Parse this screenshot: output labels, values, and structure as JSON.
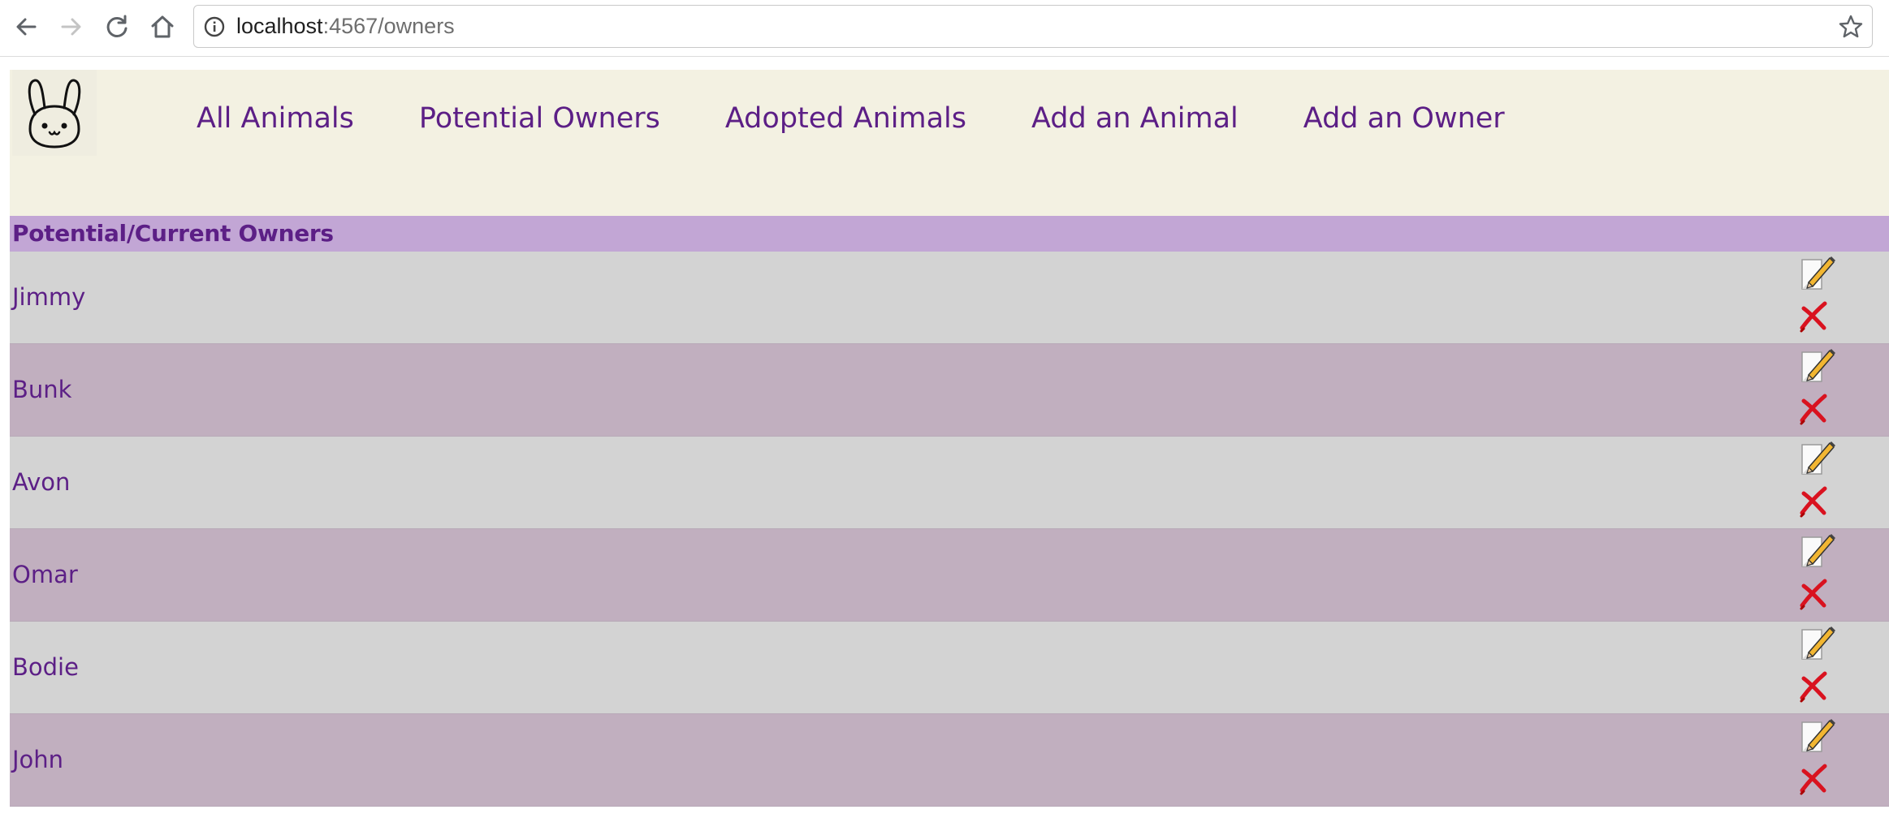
{
  "browser": {
    "url_host": "localhost",
    "url_rest": ":4567/owners"
  },
  "nav": {
    "links": [
      {
        "label": "All Animals"
      },
      {
        "label": "Potential Owners"
      },
      {
        "label": "Adopted Animals"
      },
      {
        "label": "Add an Animal"
      },
      {
        "label": "Add an Owner"
      }
    ]
  },
  "section": {
    "title": "Potential/Current Owners"
  },
  "owners": [
    {
      "name": "Jimmy"
    },
    {
      "name": "Bunk"
    },
    {
      "name": "Avon"
    },
    {
      "name": "Omar"
    },
    {
      "name": "Bodie"
    },
    {
      "name": "John"
    }
  ],
  "colors": {
    "accent": "#5c1f86",
    "header_bg": "#f3f1e2",
    "title_bg": "#c2a6d5",
    "row_light": "#d3d3d3",
    "row_dark": "#c1afbf"
  },
  "icons": {
    "logo": "bunny-logo-icon",
    "edit": "pencil-edit-icon",
    "delete": "red-x-delete-icon"
  }
}
